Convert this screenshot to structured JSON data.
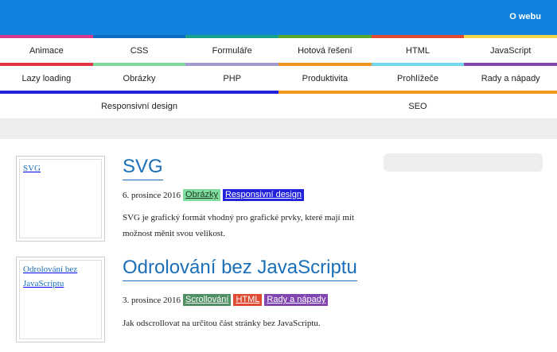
{
  "header": {
    "about_link": "O webu"
  },
  "nav": {
    "rows": [
      [
        {
          "label": "Animace",
          "color": "#d63a8e"
        },
        {
          "label": "CSS",
          "color": "#0d6bc4"
        },
        {
          "label": "Formuláře",
          "color": "#17a08c"
        },
        {
          "label": "Hotová řešení",
          "color": "#5aa82e"
        },
        {
          "label": "HTML",
          "color": "#e14b34"
        },
        {
          "label": "JavaScript",
          "color": "#f2d44a"
        }
      ],
      [
        {
          "label": "Lazy loading",
          "color": "#e03344"
        },
        {
          "label": "Obrázky",
          "color": "#7fdc9c"
        },
        {
          "label": "PHP",
          "color": "#a39ad0"
        },
        {
          "label": "Produktivita",
          "color": "#f0951e"
        },
        {
          "label": "Prohlížeče",
          "color": "#6fd6ec"
        },
        {
          "label": "Rady a nápady",
          "color": "#8145b2"
        }
      ],
      [
        {
          "label": "Responsivní design",
          "color": "#2222dd"
        },
        {
          "label": "SEO",
          "color": "#f0951e"
        }
      ]
    ]
  },
  "posts": [
    {
      "title": "SVG",
      "thumb_alt": "SVG",
      "date": "6. prosince 2016",
      "tags": [
        {
          "label": "Obrázky",
          "bg": "#7fdc9c",
          "fg": "#1a3a22"
        },
        {
          "label": "Responsivní design",
          "bg": "#2222dd",
          "fg": "#ffffff"
        }
      ],
      "excerpt": "SVG je grafický formát vhodný pro grafické prvky, které mají mít možnost měnit svou velikost."
    },
    {
      "title": "Odrolování bez JavaScriptu",
      "thumb_alt": "Odrolování bez JavaScriptu",
      "date": "3. prosince 2016",
      "tags": [
        {
          "label": "Scrollování",
          "bg": "#4f8f63",
          "fg": "#ffffff"
        },
        {
          "label": "HTML",
          "bg": "#e14b34",
          "fg": "#ffffff"
        },
        {
          "label": "Rady a nápady",
          "bg": "#8145b2",
          "fg": "#ffffff"
        }
      ],
      "excerpt": "Jak odscrollovat na určitou část stránky bez JavaScriptu."
    }
  ]
}
